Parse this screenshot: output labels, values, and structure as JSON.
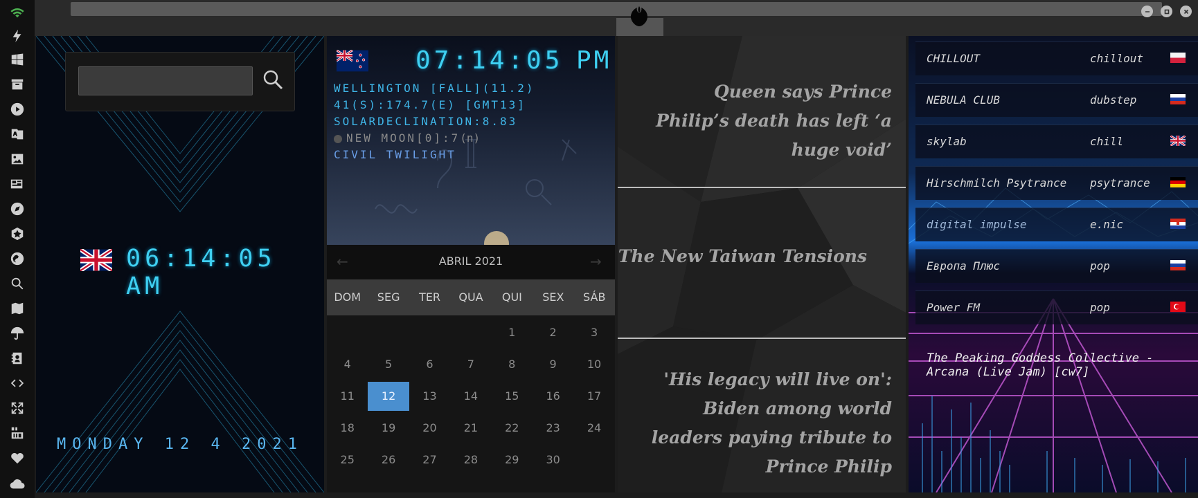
{
  "sidebar": {
    "icons": [
      "wifi-icon",
      "lightning-icon",
      "windows-icon",
      "archive-icon",
      "play-circle-icon",
      "translate-book-icon",
      "image-icon",
      "newspaper-icon",
      "compass-icon",
      "hexagon-star-icon",
      "globe-icon",
      "search-icon",
      "map-icon",
      "umbrella-icon",
      "contacts-icon",
      "code-icon",
      "expand-icon",
      "youtube-icon",
      "heart-icon",
      "cloud-icon"
    ]
  },
  "clock_uk": {
    "time": "06:14:05 AM",
    "date": "MONDAY 12 4 2021"
  },
  "clock_nz": {
    "time": "07:14:05",
    "ampm": "PM",
    "line1": "WELLINGTON [FALL](11.2)",
    "line2": "41(S):174.7(E) [GMT13]",
    "line3": "SOLARDECLINATION:8.83",
    "line4": "NEW MOON[0]:7",
    "line4_suffix": "(n)",
    "line5": "CIVIL TWILIGHT"
  },
  "calendar": {
    "title": "ABRIL 2021",
    "days": [
      "DOM",
      "SEG",
      "TER",
      "QUA",
      "QUI",
      "SEX",
      "SÁB"
    ],
    "selected": "12",
    "weeks": [
      [
        "",
        "",
        "",
        "",
        "1",
        "2",
        "3"
      ],
      [
        "4",
        "5",
        "6",
        "7",
        "8",
        "9",
        "10"
      ],
      [
        "11",
        "12",
        "13",
        "14",
        "15",
        "16",
        "17"
      ],
      [
        "18",
        "19",
        "20",
        "21",
        "22",
        "23",
        "24"
      ],
      [
        "25",
        "26",
        "27",
        "28",
        "29",
        "30",
        ""
      ]
    ]
  },
  "news": {
    "items": [
      "Queen says Prince Philip’s death has left ‘a huge void’",
      "The New Taiwan Tensions",
      "'His legacy will live on': Biden among world leaders paying tribute to Prince Philip"
    ]
  },
  "radio": {
    "stations": [
      {
        "name": "CHILLOUT",
        "genre": "chillout",
        "flag": "poland"
      },
      {
        "name": "NEBULA CLUB",
        "genre": "dubstep",
        "flag": "russia"
      },
      {
        "name": "skylab",
        "genre": "chill",
        "flag": "uk"
      },
      {
        "name": "Hirschmilch Psytrance",
        "genre": "psytrance",
        "flag": "germany"
      },
      {
        "name": "digital impulse",
        "genre": "e.nic",
        "flag": "croatia"
      },
      {
        "name": "Европа Плюс",
        "genre": "pop",
        "flag": "russia"
      },
      {
        "name": "Power FM",
        "genre": "pop",
        "flag": "turkey"
      }
    ],
    "now_playing": "The Peaking Goddess Collective - Arcana (Live Jam) [cw7]"
  }
}
